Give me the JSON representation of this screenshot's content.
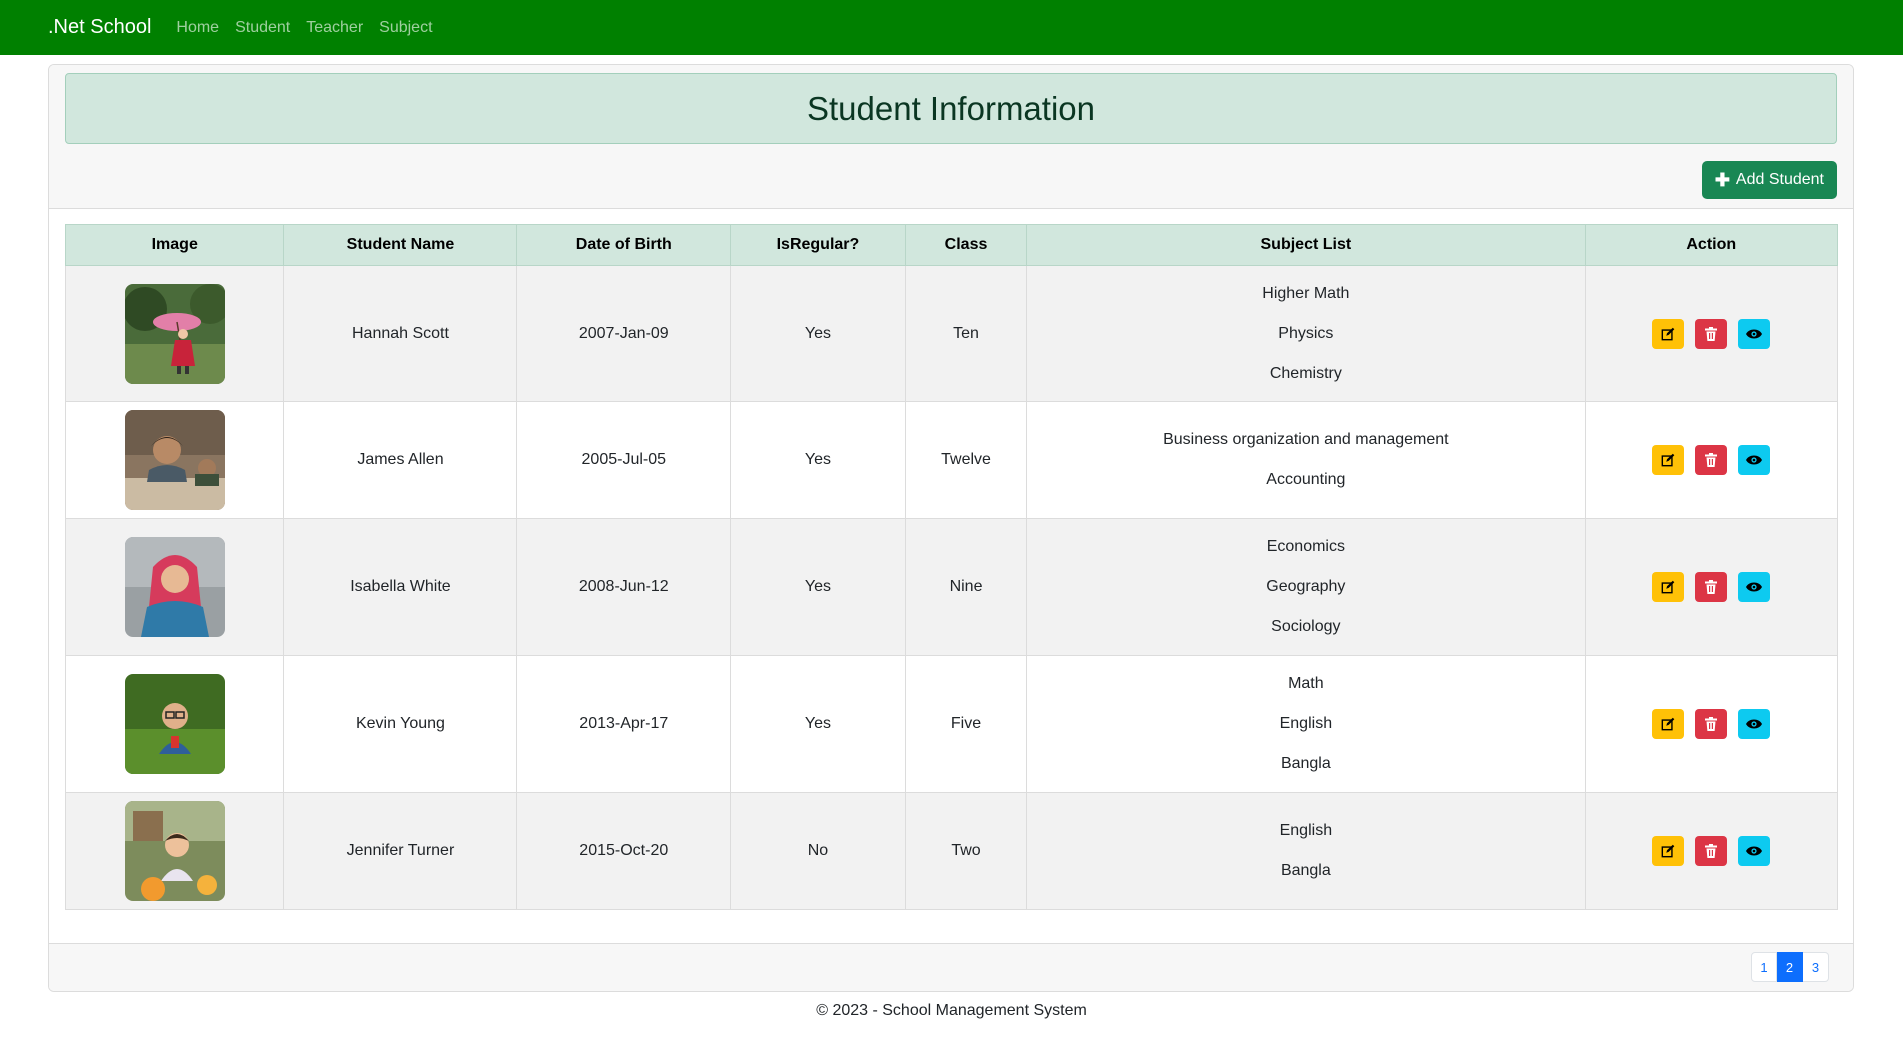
{
  "navbar": {
    "brand": ".Net School",
    "links": [
      "Home",
      "Student",
      "Teacher",
      "Subject"
    ]
  },
  "page": {
    "title": "Student Information",
    "add_button": "Add Student"
  },
  "table": {
    "headers": [
      "Image",
      "Student Name",
      "Date of Birth",
      "IsRegular?",
      "Class",
      "Subject List",
      "Action"
    ],
    "rows": [
      {
        "name": "Hannah Scott",
        "dob": "2007-Jan-09",
        "regular": "Yes",
        "class": "Ten",
        "subjects": [
          "Higher Math",
          "Physics",
          "Chemistry"
        ]
      },
      {
        "name": "James Allen",
        "dob": "2005-Jul-05",
        "regular": "Yes",
        "class": "Twelve",
        "subjects": [
          "Business organization and management",
          "Accounting"
        ]
      },
      {
        "name": "Isabella White",
        "dob": "2008-Jun-12",
        "regular": "Yes",
        "class": "Nine",
        "subjects": [
          "Economics",
          "Geography",
          "Sociology"
        ]
      },
      {
        "name": "Kevin Young",
        "dob": "2013-Apr-17",
        "regular": "Yes",
        "class": "Five",
        "subjects": [
          "Math",
          "English",
          "Bangla"
        ]
      },
      {
        "name": "Jennifer Turner",
        "dob": "2015-Oct-20",
        "regular": "No",
        "class": "Two",
        "subjects": [
          "English",
          "Bangla"
        ]
      }
    ]
  },
  "pagination": {
    "pages": [
      "1",
      "2",
      "3"
    ],
    "current": "2"
  },
  "footer": {
    "text": "© 2023 - School Management System"
  },
  "colors": {
    "navbar": "#008000",
    "header_bg": "#d1e7dd",
    "add_button": "#198754",
    "edit": "#ffc107",
    "delete": "#dc3545",
    "view": "#0dcaf0",
    "active_page": "#0d6efd"
  }
}
